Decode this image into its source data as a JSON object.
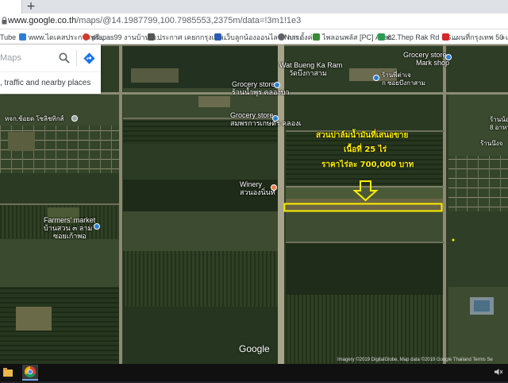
{
  "browser": {
    "new_tab_glyph": "+",
    "url_domain": "www.google.co.th",
    "url_path": "/maps/@14.1987799,100.7985553,2375m/data=!3m1!1e3",
    "bookmarks": [
      {
        "label": "Tube",
        "color": "#e02020"
      },
      {
        "label": "www.ไดเคสประกาศฟรี...",
        "color": "#2a7fd4"
      },
      {
        "label": "prapas99 งานบ้าน ซ...",
        "color": "#d03a2a"
      },
      {
        "label": "ประกาศ เคยกกรุงเทพ...",
        "color": "#555555"
      },
      {
        "label": "เว็บลูกน้องออนไลน์ Nun...",
        "color": "#2a5bb8"
      },
      {
        "label": "การตั้งค่า",
        "color": "#5f6368"
      },
      {
        "label": "ไพลอนพลัส [PC] Attac...",
        "color": "#3a8a3a"
      },
      {
        "label": "62 Thep Rak Rd - G...",
        "color": "#2a9d50"
      },
      {
        "label": "แผนที่กรุงเทพ 50 และ...",
        "color": "#d02a2a"
      },
      {
        "label": "»",
        "color": "#ffffff"
      }
    ]
  },
  "search": {
    "placeholder": "Maps",
    "layer_hint": ", traffic and nearby places"
  },
  "places": {
    "wat_en": "Wat Bueng Ka Ram",
    "wat_th": "วัดบึงกาสาม",
    "grocery1_en": "Grocery store",
    "grocery1_th": "ร้านน้ำพุร คลองบา",
    "grocery2_en": "Grocery store",
    "grocery2_th": "สมพรการเกษตร คลองเ",
    "grocery3_en": "Grocery store",
    "grocery3_th": "Mark shop",
    "shop_right1": "ร้านพี่ต่าเจ",
    "shop_right2": "ก ซอยบึงกาสาม",
    "shop_right3": "ร้านน้อ",
    "shop_right4": "8 อาหาร",
    "shop_right5": "ร้านนึงจ",
    "winery_en": "Winery",
    "winery_th": "สวนองนิ่นท์",
    "farmers_en": "Farmers' market",
    "farmers_th1": "บ้านสวน ๓ ลาม",
    "farmers_th2": "ซอยเก้าพอ",
    "left_label": "หจก.ช้อยด โซลิชทิกส์"
  },
  "advert": {
    "line1": "สวนปาล์มน้ำมันที่เสนอขาย",
    "line2": "เนื้อที่  25 ไร่",
    "line3": "ราคาไร่ละ 700,000 บาท",
    "highlight_color": "#ffee00"
  },
  "map_footer": {
    "logo": "Google",
    "attribution": "Imagery ©2019 DigitalGlobe, Map data ©2019 Google    Thailand    Terms    Se"
  },
  "taskbar": {
    "tray_icon": "speaker-icon"
  }
}
